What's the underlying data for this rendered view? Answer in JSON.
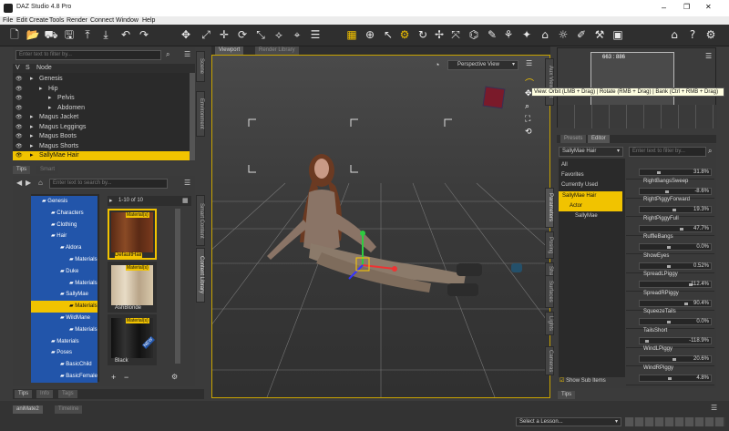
{
  "window": {
    "title": "DAZ Studio 4.8 Pro",
    "minimize": "–",
    "maximize": "❐",
    "close": "✕"
  },
  "menu": [
    "File",
    "Edit",
    "Create",
    "Tools",
    "Render",
    "Connect",
    "Window",
    "Help"
  ],
  "scene": {
    "filter_placeholder": "Enter text to filter by...",
    "col_v": "V",
    "col_s": "S",
    "col_node": "Node",
    "items": [
      {
        "label": "Genesis",
        "indent": 25,
        "selected": false
      },
      {
        "label": "Hip",
        "indent": 35,
        "selected": false
      },
      {
        "label": "Pelvis",
        "indent": 45,
        "selected": false
      },
      {
        "label": "Abdomen",
        "indent": 45,
        "selected": false
      },
      {
        "label": "Magus Jacket",
        "indent": 25,
        "selected": false
      },
      {
        "label": "Magus Leggings",
        "indent": 25,
        "selected": false
      },
      {
        "label": "Magus Boots",
        "indent": 25,
        "selected": false
      },
      {
        "label": "Magus Shorts",
        "indent": 25,
        "selected": false
      },
      {
        "label": "SallyMae Hair",
        "indent": 25,
        "selected": true
      }
    ]
  },
  "left_side_tabs": [
    "Scene",
    "Environment"
  ],
  "mid_tabs": {
    "tips": "Tips",
    "smart": "Smart"
  },
  "content": {
    "search_placeholder": "Enter text to search by...",
    "count": "1-10 of 10",
    "tree": [
      {
        "label": "Genesis",
        "x": 12
      },
      {
        "label": "Characters",
        "x": 22
      },
      {
        "label": "Clothing",
        "x": 22
      },
      {
        "label": "Hair",
        "x": 22
      },
      {
        "label": "Aldora",
        "x": 32
      },
      {
        "label": "Materials",
        "x": 42
      },
      {
        "label": "Duke",
        "x": 32
      },
      {
        "label": "Materials",
        "x": 42
      },
      {
        "label": "SallyMae",
        "x": 32
      },
      {
        "label": "Materials",
        "x": 42
      },
      {
        "label": "WildMane",
        "x": 32
      },
      {
        "label": "Materials",
        "x": 42
      },
      {
        "label": "Materials",
        "x": 22
      },
      {
        "label": "Poses",
        "x": 22
      },
      {
        "label": "BasicChild",
        "x": 32
      },
      {
        "label": "BasicFemale",
        "x": 32
      }
    ],
    "selected_index": 9,
    "thumbs": [
      {
        "label": "DefaultHair",
        "badge": "Material(s)",
        "selected": true
      },
      {
        "label": "AshBlonde",
        "badge": "Material(s)",
        "selected": false
      },
      {
        "label": "Black",
        "badge": "Material(s)",
        "selected": false,
        "tag": "NEW"
      }
    ],
    "side_tabs": [
      "Smart Content",
      "Content Library"
    ]
  },
  "bottom_left_tabs": [
    "Tips",
    "Info",
    "Tags"
  ],
  "viewport": {
    "tabs": [
      "Viewport",
      "Render Library"
    ],
    "view": "Perspective View",
    "tooltip": "View: Orbit (LMB + Drag) | Rotate (RMB + Drag) | Bank (Ctrl + RMB + Drag)"
  },
  "aux": {
    "resolution": "663 : 886",
    "side_tab": "Aux Viewport"
  },
  "params": {
    "tabs": [
      "Presets",
      "Editor"
    ],
    "node": "SallyMae Hair",
    "filter_placeholder": "Enter text to filter by...",
    "groups": [
      "All",
      "Favorites",
      "Currently Used",
      "SallyMae Hair",
      "Actor",
      "SallyMae"
    ],
    "show_sub_items": "Show Sub Items",
    "sliders": [
      {
        "name": "",
        "value": "31.8%",
        "pos": 0.32
      },
      {
        "name": "RightBangsSweep",
        "value": "-8.6%",
        "pos": 0.46
      },
      {
        "name": "RightPiggyForward",
        "value": "19.3%",
        "pos": 0.6
      },
      {
        "name": "RightPiggyFull",
        "value": "47.7%",
        "pos": 0.74
      },
      {
        "name": "RuffleBangs",
        "value": "0.0%",
        "pos": 0.5
      },
      {
        "name": "ShowEyes",
        "value": "0.52%",
        "pos": 0.5
      },
      {
        "name": "SpreadLPiggy",
        "value": "112.4%",
        "pos": 0.9
      },
      {
        "name": "SpreadRPiggy",
        "value": "90.4%",
        "pos": 0.82
      },
      {
        "name": "SqueezeTails",
        "value": "0.0%",
        "pos": 0.5
      },
      {
        "name": "TailsShort",
        "value": "-118.9%",
        "pos": 0.1
      },
      {
        "name": "WindLPiggy",
        "value": "20.6%",
        "pos": 0.6
      },
      {
        "name": "WindRPiggy",
        "value": "4.8%",
        "pos": 0.52
      }
    ],
    "side_tabs": [
      "Parameters",
      "Posing",
      "Shaping",
      "Surfaces",
      "Lights",
      "Cameras"
    ]
  },
  "right_tips": "Tips",
  "bottom": {
    "tabs": [
      "aniMate2",
      "Timeline"
    ],
    "lesson": "Select a Lesson..."
  },
  "colors": {
    "accent": "#f1c300",
    "library_blue": "#2255aa"
  }
}
